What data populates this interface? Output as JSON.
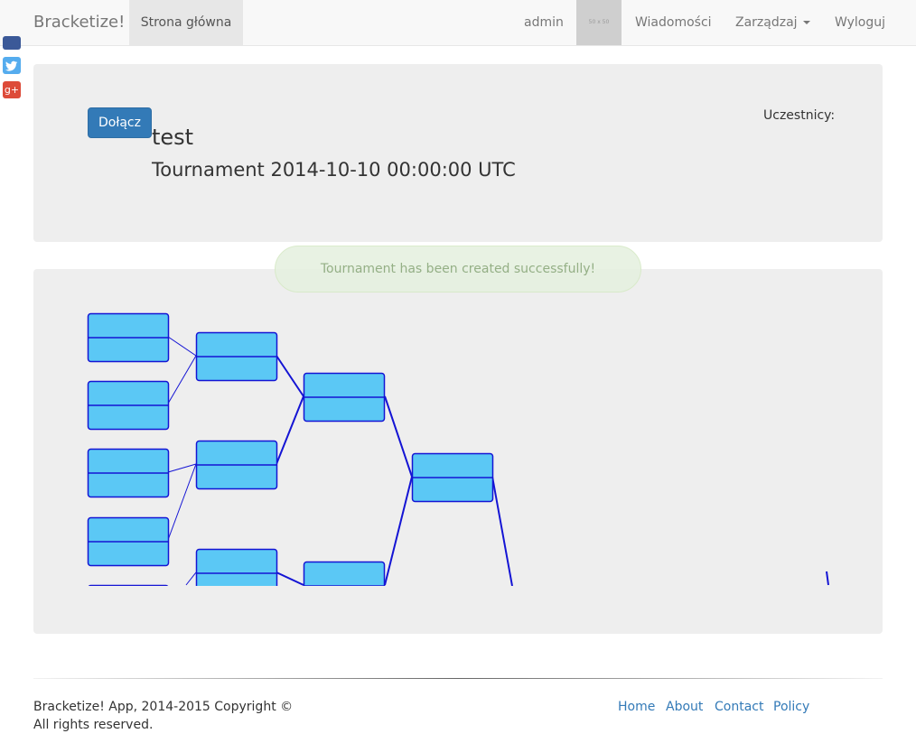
{
  "navbar": {
    "brand": "Bracketize!",
    "home": "Strona główna",
    "user": "admin",
    "avatar_placeholder": "50 x 50",
    "messages": "Wiadomości",
    "manage": "Zarządzaj",
    "logout": "Wyloguj"
  },
  "social": {
    "facebook_icon": "facebook-icon",
    "twitter_icon": "twitter-icon",
    "googleplus_icon": "google-plus-icon",
    "googleplus_glyph": "g+",
    "twitter_glyph": "🐦",
    "colors": {
      "facebook": "#3b5998",
      "twitter": "#55acee",
      "googleplus": "#dd4b39"
    }
  },
  "tournament": {
    "join_button": "Dołącz",
    "name": "test",
    "subtitle": "Tournament 2014-10-10 00:00:00 UTC",
    "participants_label": "Uczestnicy:"
  },
  "toast": {
    "message": "Tournament has been created successfully!"
  },
  "bracket": {
    "box_fill": "#5bc8f5",
    "line_color": "#1414d4"
  },
  "footer": {
    "copyright_line1": "Bracketize! App, 2014-2015 Copyright ©",
    "copyright_line2": "All rights reserved.",
    "links": [
      "Home",
      "About",
      "Contact",
      "Policy"
    ]
  }
}
